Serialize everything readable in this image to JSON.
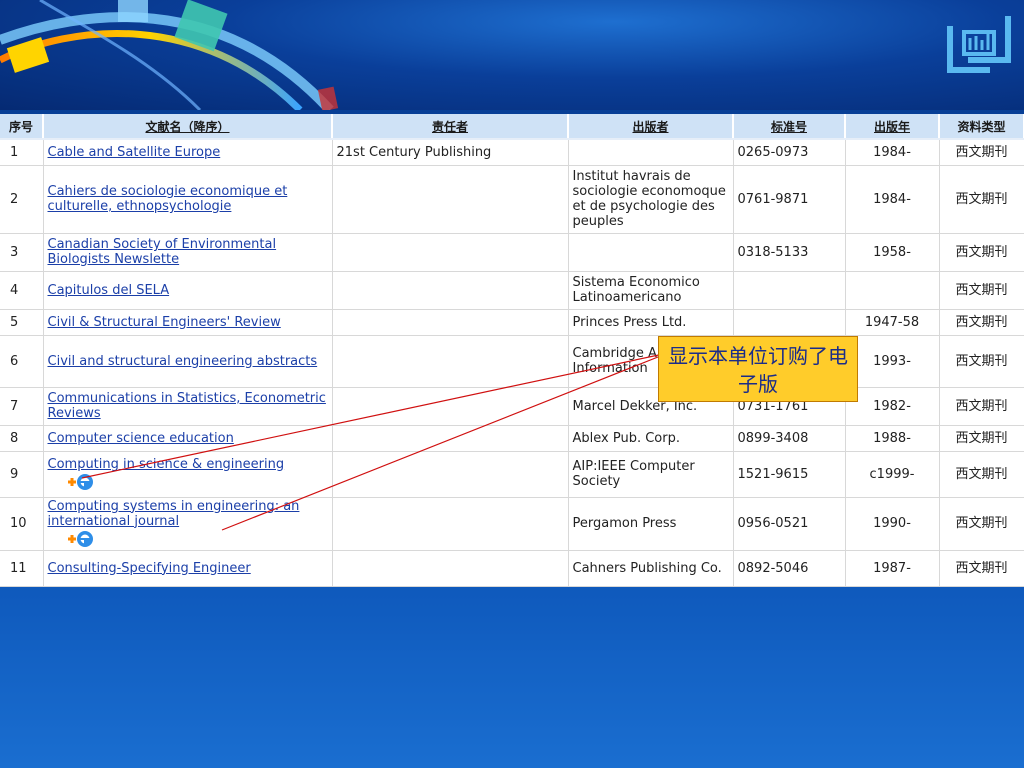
{
  "headers": {
    "seq": "序号",
    "title": "文献名（降序）",
    "author": "责任者",
    "publisher": "出版者",
    "issn": "标准号",
    "year": "出版年",
    "type": "资料类型"
  },
  "rows": [
    {
      "no": "1",
      "title": "Cable and Satellite Europe",
      "author": "21st Century Publishing",
      "publisher": "",
      "issn": "0265-0973",
      "year": "1984-",
      "type": "西文期刊",
      "ejournal": false
    },
    {
      "no": "2",
      "title": "Cahiers de sociologie economique et culturelle, ethnopsychologie",
      "author": "",
      "publisher": "Institut havrais de sociologie economoque et de psychologie des peuples",
      "issn": "0761-9871",
      "year": "1984-",
      "type": "西文期刊",
      "ejournal": false
    },
    {
      "no": "3",
      "title": "Canadian Society of Environmental Biologists Newslette",
      "author": "",
      "publisher": "",
      "issn": "0318-5133",
      "year": "1958-",
      "type": "西文期刊",
      "ejournal": false
    },
    {
      "no": "4",
      "title": "Capitulos del SELA",
      "author": "",
      "publisher": "Sistema Economico Latinoamericano",
      "issn": "",
      "year": "",
      "type": "西文期刊",
      "ejournal": false
    },
    {
      "no": "5",
      "title": "Civil & Structural Engineers' Review",
      "author": "",
      "publisher": "Princes Press Ltd.",
      "issn": "",
      "year": "1947-58",
      "type": "西文期刊",
      "ejournal": false
    },
    {
      "no": "6",
      "title": "Civil and structural engineering abstracts",
      "author": "",
      "publisher": "Cambridge Abstracts:E Information",
      "issn": "",
      "year": "1993-",
      "type": "西文期刊",
      "ejournal": false
    },
    {
      "no": "7",
      "title": "Communications in Statistics, Econometric Reviews",
      "author": "",
      "publisher": "Marcel Dekker, Inc.",
      "issn": "0731-1761",
      "year": "1982-",
      "type": "西文期刊",
      "ejournal": false
    },
    {
      "no": "8",
      "title": "Computer science education",
      "author": "",
      "publisher": "Ablex Pub. Corp.",
      "issn": "0899-3408",
      "year": "1988-",
      "type": "西文期刊",
      "ejournal": false
    },
    {
      "no": "9",
      "title": "Computing in science & engineering",
      "author": "",
      "publisher": "AIP:IEEE Computer Society",
      "issn": "1521-9615",
      "year": "c1999-",
      "type": "西文期刊",
      "ejournal": true
    },
    {
      "no": "10",
      "title": "Computing systems in engineering: an international journal",
      "author": "",
      "publisher": "Pergamon Press",
      "issn": "0956-0521",
      "year": "1990-",
      "type": "西文期刊",
      "ejournal": true
    },
    {
      "no": "11",
      "title": "Consulting-Specifying Engineer",
      "author": "",
      "publisher": "Cahners Publishing Co.",
      "issn": "0892-5046",
      "year": "1987-",
      "type": "西文期刊",
      "ejournal": false
    }
  ],
  "callout": "显示本单位订购了电子版",
  "colors": {
    "callout_bg": "#ffcc2a",
    "header_bg": "#cfe2f6",
    "link": "#1b3fa8",
    "pointer": "#d01010"
  },
  "icons": {
    "ejournal": "ie-plus-icon",
    "logo": "library-logo-icon"
  }
}
